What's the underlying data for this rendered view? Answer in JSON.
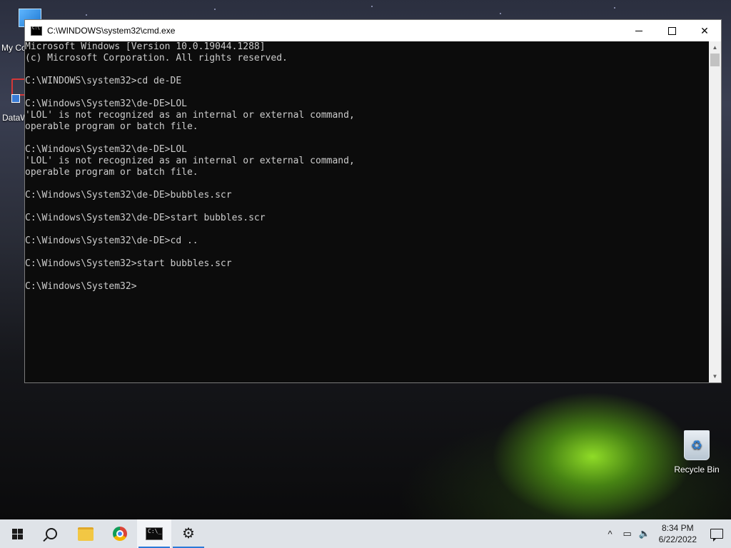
{
  "desktop": {
    "icons": [
      {
        "label": "My Co"
      },
      {
        "label": "DataW"
      },
      {
        "label": "Recycle Bin"
      }
    ]
  },
  "window": {
    "title": "C:\\WINDOWS\\system32\\cmd.exe",
    "controls": {
      "minimize": "minimize",
      "maximize": "maximize",
      "close": "✕"
    }
  },
  "console": {
    "lines": [
      "Microsoft Windows [Version 10.0.19044.1288]",
      "(c) Microsoft Corporation. All rights reserved.",
      "",
      "C:\\WINDOWS\\system32>cd de-DE",
      "",
      "C:\\Windows\\System32\\de-DE>LOL",
      "'LOL' is not recognized as an internal or external command,",
      "operable program or batch file.",
      "",
      "C:\\Windows\\System32\\de-DE>LOL",
      "'LOL' is not recognized as an internal or external command,",
      "operable program or batch file.",
      "",
      "C:\\Windows\\System32\\de-DE>bubbles.scr",
      "",
      "C:\\Windows\\System32\\de-DE>start bubbles.scr",
      "",
      "C:\\Windows\\System32\\de-DE>cd ..",
      "",
      "C:\\Windows\\System32>start bubbles.scr",
      "",
      "C:\\Windows\\System32>"
    ]
  },
  "taskbar": {
    "items": [
      {
        "name": "start",
        "icon": "windows-logo-icon"
      },
      {
        "name": "search",
        "icon": "search-icon"
      },
      {
        "name": "file-explorer",
        "icon": "folder-icon"
      },
      {
        "name": "chrome",
        "icon": "chrome-icon"
      },
      {
        "name": "cmd",
        "icon": "cmd-icon",
        "active": true
      },
      {
        "name": "settings",
        "icon": "gear-icon",
        "active": true
      }
    ],
    "tray": {
      "chevron": "^",
      "time": "8:34 PM",
      "date": "6/22/2022"
    }
  },
  "colors": {
    "console_bg": "#0c0c0c",
    "console_fg": "#cccccc",
    "taskbar_bg": "#dfe3e8",
    "accent": "#2b7ad8"
  }
}
